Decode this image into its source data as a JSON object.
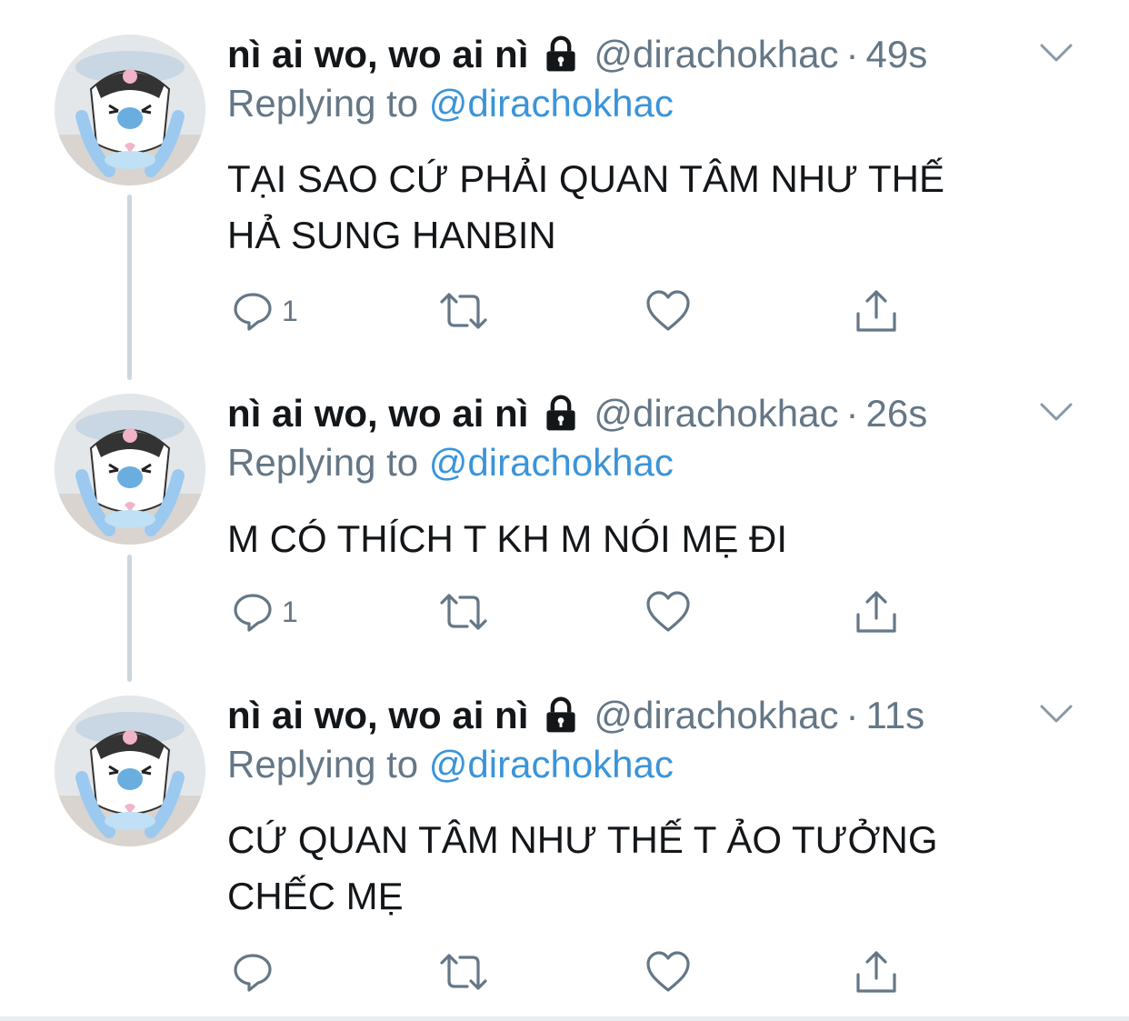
{
  "tweets": [
    {
      "name": "nì ai wo, wo ai nì",
      "handle": "@dirachokhac",
      "separator": "·",
      "time": "49s",
      "replying_prefix": "Replying to",
      "replying_handle": "@dirachokhac",
      "text_lines": [
        "TẠI SAO CỨ PHẢI QUAN TÂM NHƯ THẾ",
        "HẢ SUNG HANBIN"
      ],
      "reply_count": "1"
    },
    {
      "name": "nì ai wo, wo ai nì",
      "handle": "@dirachokhac",
      "separator": "·",
      "time": "26s",
      "replying_prefix": "Replying to",
      "replying_handle": "@dirachokhac",
      "text_lines": [
        "M CÓ THÍCH T KH M NÓI MẸ ĐI"
      ],
      "reply_count": "1"
    },
    {
      "name": "nì ai wo, wo ai nì",
      "handle": "@dirachokhac",
      "separator": "·",
      "time": "11s",
      "replying_prefix": "Replying to",
      "replying_handle": "@dirachokhac",
      "text_lines": [
        "CỨ QUAN TÂM NHƯ THẾ T ẢO TƯỞNG",
        "CHẾC MẸ"
      ],
      "reply_count": ""
    }
  ],
  "icons": {
    "lock": "lock-icon",
    "caret": "chevron-down-icon",
    "reply": "reply-icon",
    "retweet": "retweet-icon",
    "like": "heart-icon",
    "share": "share-icon"
  },
  "colors": {
    "text": "#14171a",
    "secondary": "#657786",
    "link": "#3b94d9",
    "thread_line": "#cdd6dd"
  }
}
